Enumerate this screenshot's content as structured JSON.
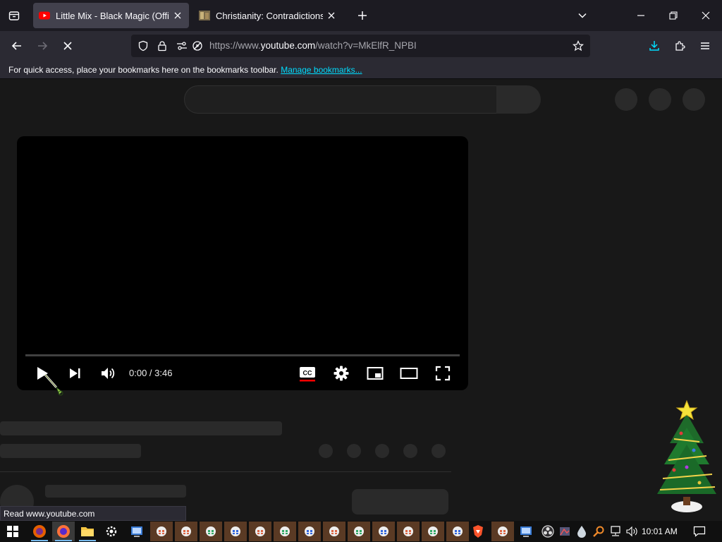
{
  "browser": {
    "tabs": [
      {
        "title": "Little Mix - Black Magic (Official",
        "active": true,
        "favicon": "youtube-icon"
      },
      {
        "title": "Christianity: Contradictions and",
        "active": false,
        "favicon": "image-thumbnail-icon"
      }
    ],
    "url": {
      "prefix": "https://www.",
      "domain": "youtube.com",
      "suffix": "/watch?v=MkElfR_NPBI"
    },
    "bookmarks_bar": {
      "message": "For quick access, place your bookmarks here on the bookmarks toolbar.",
      "link": "Manage bookmarks..."
    },
    "status_tooltip": "Read www.youtube.com"
  },
  "player": {
    "time": "0:00 / 3:46",
    "progress": 0,
    "controls": [
      "play-icon",
      "next-icon",
      "volume-icon",
      "cc-icon",
      "settings-icon",
      "miniplayer-icon",
      "theater-icon",
      "fullscreen-icon"
    ]
  },
  "taskbar": {
    "clock": "10:01 AM"
  },
  "colors": {
    "accent": "#00ddff",
    "youtube_red": "#ff0000",
    "page_bg": "#181818",
    "skeleton": "#2a2a2a"
  }
}
